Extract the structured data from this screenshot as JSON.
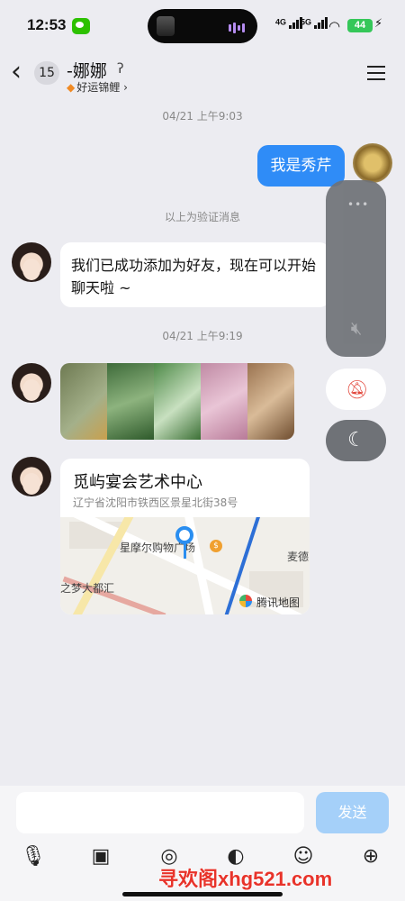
{
  "status_bar": {
    "time": "12:53",
    "signal1_label": "4G",
    "signal2_label": "5G",
    "battery": "44"
  },
  "header": {
    "back_icon": "chevron-left",
    "unread_count": "15",
    "contact_name": "-娜娜",
    "status_text": "好运锦鲤",
    "status_chevron": "›",
    "menu_icon": "hamburger"
  },
  "messages": {
    "ts1": "04/21 上午9:03",
    "me_text": "我是秀芹",
    "verify_note": "以上为验证消息",
    "friend_text": "我们已成功添加为好友，现在可以开始聊天啦 ~",
    "ts2": "04/21 上午9:19",
    "location": {
      "name": "觅屿宴会艺术中心",
      "address": "辽宁省沈阳市铁西区景星北街38号",
      "map_poi1": "星摩尔购物广场",
      "map_poi2": "麦德",
      "map_poi3": "之梦大都汇",
      "map_brand": "腾讯地图"
    }
  },
  "input": {
    "placeholder": "",
    "send_label": "发送"
  },
  "toolbar_icons": [
    "microphone-icon",
    "image-icon",
    "camera-icon",
    "sticker-icon",
    "emoji-icon",
    "plus-icon"
  ],
  "watermark": "寻欢阁xhg521.com",
  "colors": {
    "accent": "#2f8cf7",
    "send_disabled": "#a5d0f9",
    "background": "#ececf1"
  }
}
